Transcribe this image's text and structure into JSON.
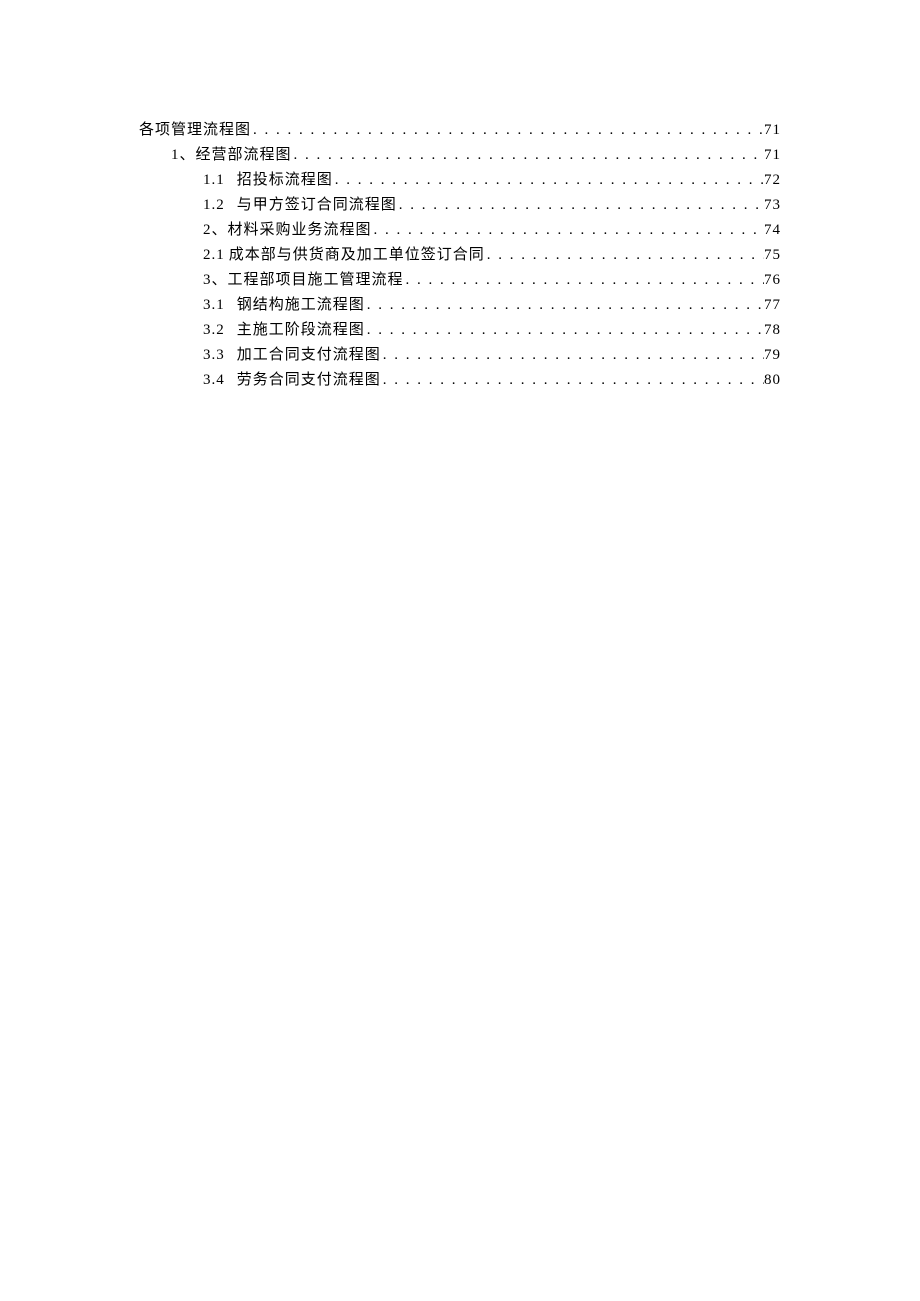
{
  "toc": [
    {
      "level": 1,
      "prefix": "",
      "title": "各项管理流程图",
      "page": "71"
    },
    {
      "level": 2,
      "prefix": "1、",
      "title": "经营部流程图",
      "page": "71"
    },
    {
      "level": 3,
      "prefix": "1.1",
      "title": "招投标流程图",
      "page": "72"
    },
    {
      "level": 3,
      "prefix": "1.2",
      "title": "与甲方签订合同流程图",
      "page": "73"
    },
    {
      "level": 3,
      "prefix": "2、",
      "title": "材料采购业务流程图",
      "page": "74"
    },
    {
      "level": 3,
      "prefix": "2.1",
      "title": "成本部与供货商及加工单位签订合同",
      "page": "75"
    },
    {
      "level": 3,
      "prefix": "3、",
      "title": "工程部项目施工管理流程",
      "page": "76"
    },
    {
      "level": 3,
      "prefix": "3.1",
      "title": "钢结构施工流程图",
      "page": "77"
    },
    {
      "level": 3,
      "prefix": "3.2",
      "title": "主施工阶段流程图",
      "page": "78"
    },
    {
      "level": 3,
      "prefix": "3.3",
      "title": "加工合同支付流程图",
      "page": "79"
    },
    {
      "level": 3,
      "prefix": "3.4",
      "title": "劳务合同支付流程图",
      "page": "80"
    }
  ]
}
